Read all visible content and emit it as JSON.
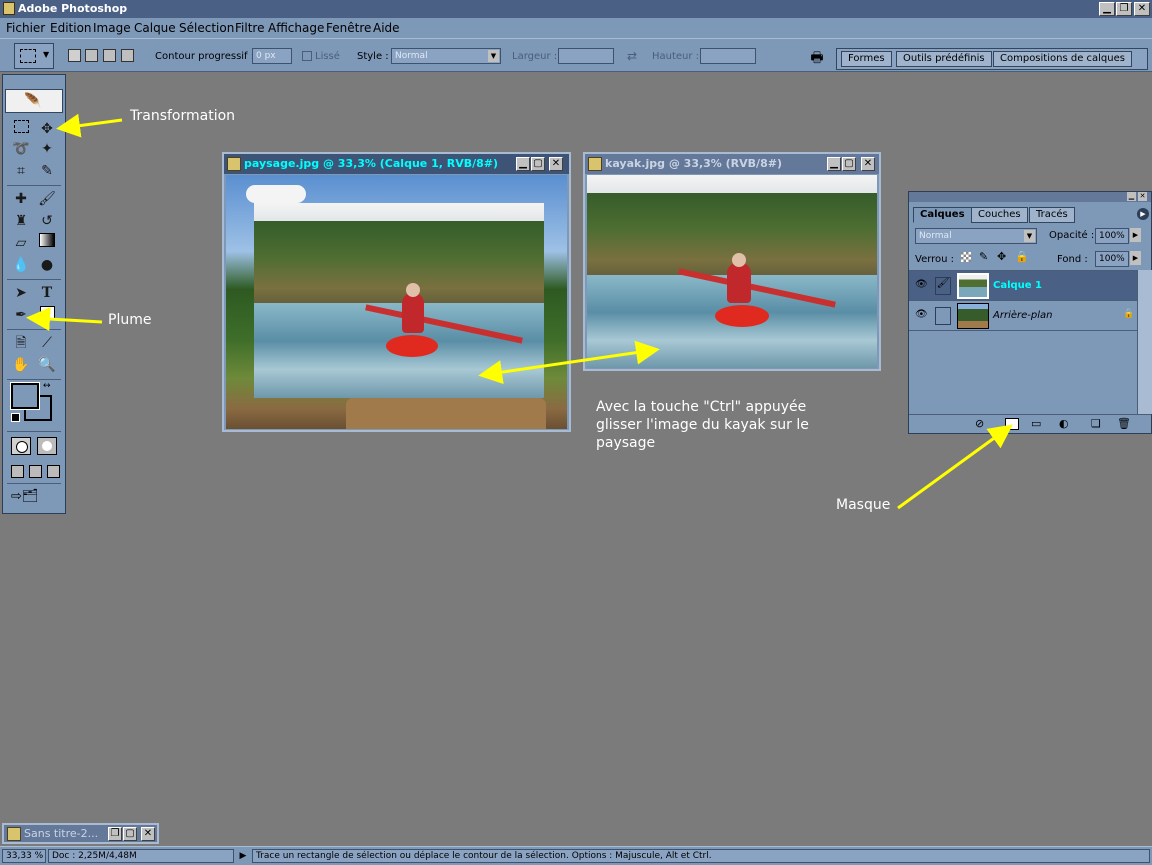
{
  "app": {
    "title": "Adobe Photoshop"
  },
  "menu": [
    "Fichier",
    "Edition",
    "Image",
    "Calque",
    "Sélection",
    "Filtre",
    "Affichage",
    "Fenêtre",
    "Aide"
  ],
  "options": {
    "feather_label": "Contour progressif :",
    "feather_value": "0 px",
    "antialias_label": "Lissé",
    "style_label": "Style :",
    "style_value": "Normal",
    "width_label": "Largeur :",
    "height_label": "Hauteur :"
  },
  "palette_tabs": [
    "Formes",
    "Outils prédéfinis",
    "Compositions de calques"
  ],
  "documents": [
    {
      "title": "paysage.jpg @ 33,3% (Calque 1, RVB/8#)"
    },
    {
      "title": "kayak.jpg @ 33,3% (RVB/8#)"
    }
  ],
  "layers_panel": {
    "tabs": [
      "Calques",
      "Couches",
      "Tracés"
    ],
    "blend_mode": "Normal",
    "opacity_label": "Opacité :",
    "opacity_value": "100%",
    "lock_label": "Verrou :",
    "fill_label": "Fond :",
    "fill_value": "100%",
    "layers": [
      {
        "name": "Calque 1",
        "selected": true
      },
      {
        "name": "Arrière-plan",
        "selected": false
      }
    ]
  },
  "annotations": {
    "transformation": "Transformation",
    "plume": "Plume",
    "instruction_line1": "Avec la touche \"Ctrl\" appuyée",
    "instruction_line2": "glisser l'image du kayak sur le",
    "instruction_line3": "paysage",
    "masque": "Masque"
  },
  "minimized_doc": {
    "title": "Sans titre-2..."
  },
  "status": {
    "zoom": "33,33 %",
    "doc": "Doc : 2,25M/4,48M",
    "message": "Trace un rectangle de sélection ou déplace le contour de la sélection. Options : Majuscule, Alt et Ctrl."
  },
  "colors": {
    "accent_title": "#00ffff",
    "annotation_arrow": "#ffff00",
    "workspace": "#7b7b7b"
  }
}
